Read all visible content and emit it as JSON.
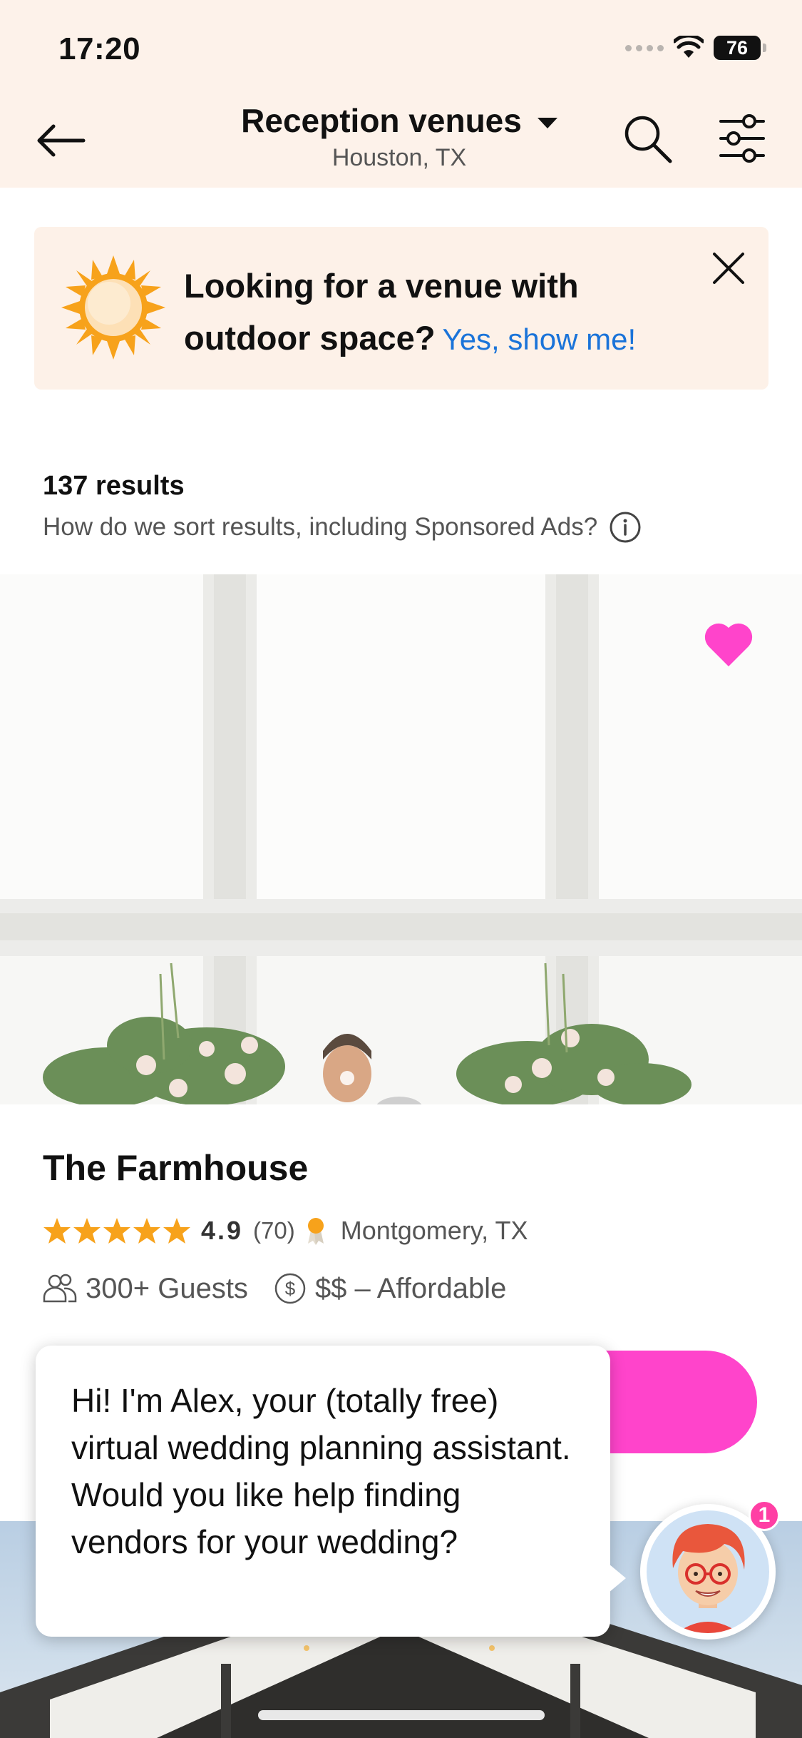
{
  "status_bar": {
    "time": "17:20",
    "battery": "76"
  },
  "header": {
    "title": "Reception venues",
    "subtitle": "Houston, TX"
  },
  "banner": {
    "text": "Looking for a venue with outdoor space?",
    "link": "Yes, show me!"
  },
  "results": {
    "count": "137 results",
    "sort_note": "How do we sort results, including Sponsored Ads?"
  },
  "listing": {
    "name": "The Farmhouse",
    "rating": "4.9",
    "rating_stars": 5,
    "review_count": "(70)",
    "location": "Montgomery, TX",
    "guests": "300+ Guests",
    "price": "$$ – Affordable",
    "favorited": true
  },
  "chat": {
    "message": "Hi! I'm Alex, your (totally free) virtual wedding planning assistant. Would you like help finding vendors for your wedding?",
    "badge_count": "1"
  },
  "colors": {
    "header_bg": "#fdf2ea",
    "accent_pink": "#ff44cb",
    "link_blue": "#1a73d9",
    "star_orange": "#f7a21b"
  }
}
